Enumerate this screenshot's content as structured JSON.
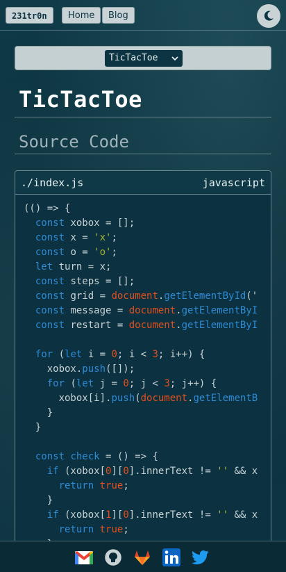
{
  "nav": {
    "brand": "231tr0n",
    "home": "Home",
    "blog": "Blog"
  },
  "selector": {
    "selected": "TicTacToe"
  },
  "page": {
    "title": "TicTacToe",
    "section": "Source Code"
  },
  "code_file": {
    "path": "./index.js",
    "language": "javascript"
  },
  "code_lines": [
    [
      [
        "p",
        "(() => {"
      ]
    ],
    [
      [
        "p",
        "  "
      ],
      [
        "k",
        "const"
      ],
      [
        "p",
        " xobox = [];"
      ]
    ],
    [
      [
        "p",
        "  "
      ],
      [
        "k",
        "const"
      ],
      [
        "p",
        " x = "
      ],
      [
        "s",
        "'x'"
      ],
      [
        "p",
        ";"
      ]
    ],
    [
      [
        "p",
        "  "
      ],
      [
        "k",
        "const"
      ],
      [
        "p",
        " o = "
      ],
      [
        "s",
        "'o'"
      ],
      [
        "p",
        ";"
      ]
    ],
    [
      [
        "p",
        "  "
      ],
      [
        "k",
        "let"
      ],
      [
        "p",
        " turn = x;"
      ]
    ],
    [
      [
        "p",
        "  "
      ],
      [
        "k",
        "const"
      ],
      [
        "p",
        " steps = [];"
      ]
    ],
    [
      [
        "p",
        "  "
      ],
      [
        "k",
        "const"
      ],
      [
        "p",
        " grid = "
      ],
      [
        "d",
        "document"
      ],
      [
        "p",
        "."
      ],
      [
        "f",
        "getElementById"
      ],
      [
        "p",
        "('"
      ]
    ],
    [
      [
        "p",
        "  "
      ],
      [
        "k",
        "const"
      ],
      [
        "p",
        " message = "
      ],
      [
        "d",
        "document"
      ],
      [
        "p",
        "."
      ],
      [
        "f",
        "getElementByI"
      ]
    ],
    [
      [
        "p",
        "  "
      ],
      [
        "k",
        "const"
      ],
      [
        "p",
        " restart = "
      ],
      [
        "d",
        "document"
      ],
      [
        "p",
        "."
      ],
      [
        "f",
        "getElementByI"
      ]
    ],
    [
      [
        "p",
        ""
      ]
    ],
    [
      [
        "p",
        "  "
      ],
      [
        "k",
        "for"
      ],
      [
        "p",
        " ("
      ],
      [
        "k",
        "let"
      ],
      [
        "p",
        " i = "
      ],
      [
        "n",
        "0"
      ],
      [
        "p",
        "; i < "
      ],
      [
        "n",
        "3"
      ],
      [
        "p",
        "; i++) {"
      ]
    ],
    [
      [
        "p",
        "    xobox."
      ],
      [
        "f",
        "push"
      ],
      [
        "p",
        "([]);"
      ]
    ],
    [
      [
        "p",
        "    "
      ],
      [
        "k",
        "for"
      ],
      [
        "p",
        " ("
      ],
      [
        "k",
        "let"
      ],
      [
        "p",
        " j = "
      ],
      [
        "n",
        "0"
      ],
      [
        "p",
        "; j < "
      ],
      [
        "n",
        "3"
      ],
      [
        "p",
        "; j++) {"
      ]
    ],
    [
      [
        "p",
        "      xobox[i]."
      ],
      [
        "f",
        "push"
      ],
      [
        "p",
        "("
      ],
      [
        "d",
        "document"
      ],
      [
        "p",
        "."
      ],
      [
        "f",
        "getElementB"
      ]
    ],
    [
      [
        "p",
        "    }"
      ]
    ],
    [
      [
        "p",
        "  }"
      ]
    ],
    [
      [
        "p",
        ""
      ]
    ],
    [
      [
        "p",
        "  "
      ],
      [
        "k",
        "const"
      ],
      [
        "p",
        " "
      ],
      [
        "f",
        "check"
      ],
      [
        "p",
        " = () => {"
      ]
    ],
    [
      [
        "p",
        "    "
      ],
      [
        "k",
        "if"
      ],
      [
        "p",
        " (xobox["
      ],
      [
        "n",
        "0"
      ],
      [
        "p",
        "]["
      ],
      [
        "n",
        "0"
      ],
      [
        "p",
        "].innerText != "
      ],
      [
        "s",
        "''"
      ],
      [
        "p",
        " && x"
      ]
    ],
    [
      [
        "p",
        "      "
      ],
      [
        "k",
        "return"
      ],
      [
        "p",
        " "
      ],
      [
        "n",
        "true"
      ],
      [
        "p",
        ";"
      ]
    ],
    [
      [
        "p",
        "    }"
      ]
    ],
    [
      [
        "p",
        "    "
      ],
      [
        "k",
        "if"
      ],
      [
        "p",
        " (xobox["
      ],
      [
        "n",
        "1"
      ],
      [
        "p",
        "]["
      ],
      [
        "n",
        "0"
      ],
      [
        "p",
        "].innerText != "
      ],
      [
        "s",
        "''"
      ],
      [
        "p",
        " && x"
      ]
    ],
    [
      [
        "p",
        "      "
      ],
      [
        "k",
        "return"
      ],
      [
        "p",
        " "
      ],
      [
        "n",
        "true"
      ],
      [
        "p",
        ";"
      ]
    ],
    [
      [
        "p",
        "    }"
      ]
    ]
  ],
  "footer_icons": [
    "gmail-icon",
    "github-icon",
    "gitlab-icon",
    "linkedin-icon",
    "twitter-icon"
  ],
  "colors": {
    "background": "#0d3442",
    "keyword": "#2e8bd6",
    "string": "#a8b632",
    "number": "#e2501e",
    "button": "#c9d3d6"
  }
}
